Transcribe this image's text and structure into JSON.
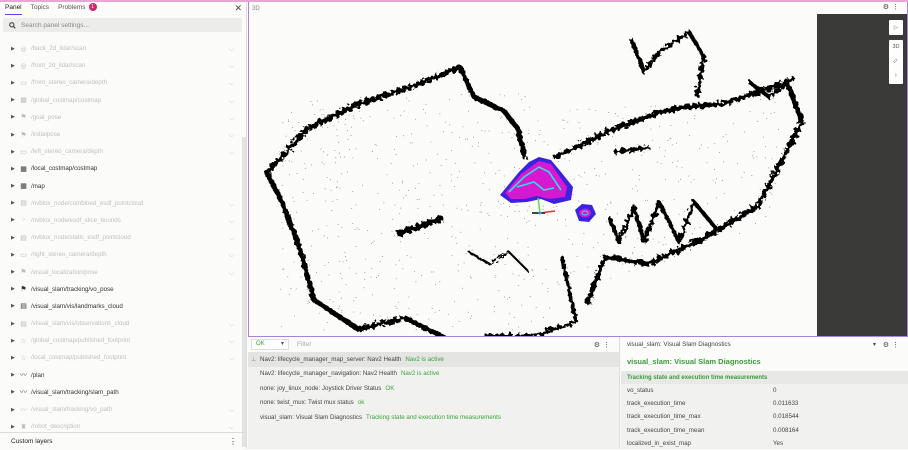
{
  "sidebar": {
    "tabs": [
      {
        "label": "Panel",
        "active": true
      },
      {
        "label": "Topics"
      },
      {
        "label": "Problems",
        "badge": "1"
      }
    ],
    "search_placeholder": "Search panel settings...",
    "topics": [
      {
        "label": "/back_2d_lidar/scan",
        "icon": "lidar-icon",
        "visible": false
      },
      {
        "label": "/front_2d_lidar/scan",
        "icon": "lidar-icon",
        "visible": false
      },
      {
        "label": "/front_stereo_camera/depth",
        "icon": "image-icon",
        "visible": false
      },
      {
        "label": "/global_costmap/costmap",
        "icon": "grid-icon",
        "visible": false
      },
      {
        "label": "/goal_pose",
        "icon": "flag-icon",
        "visible": false
      },
      {
        "label": "/initialpose",
        "icon": "flag-icon",
        "visible": false
      },
      {
        "label": "/left_stereo_camera/depth",
        "icon": "image-icon",
        "visible": false
      },
      {
        "label": "/local_costmap/costmap",
        "icon": "grid-icon",
        "visible": true
      },
      {
        "label": "/map",
        "icon": "grid-icon",
        "visible": true
      },
      {
        "label": "/nvblox_node/combined_esdf_pointcloud",
        "icon": "pointcloud-icon",
        "visible": false
      },
      {
        "label": "/nvblox_node/esdf_slice_bounds",
        "icon": "bounds-icon",
        "visible": false
      },
      {
        "label": "/nvblox_node/static_esdf_pointcloud",
        "icon": "pointcloud-icon",
        "visible": false
      },
      {
        "label": "/right_stereo_camera/depth",
        "icon": "image-icon",
        "visible": false
      },
      {
        "label": "/visual_localization/pose",
        "icon": "flag-icon",
        "visible": false
      },
      {
        "label": "/visual_slam/tracking/vo_pose",
        "icon": "flag-icon",
        "visible": true
      },
      {
        "label": "/visual_slam/vis/landmarks_cloud",
        "icon": "pointcloud-icon",
        "visible": true
      },
      {
        "label": "/visual_slam/vis/observations_cloud",
        "icon": "pointcloud-icon",
        "visible": false
      },
      {
        "label": "/global_costmap/published_footprint",
        "icon": "star-icon",
        "visible": false
      },
      {
        "label": "/local_costmap/published_footprint",
        "icon": "star-icon",
        "visible": false
      },
      {
        "label": "/plan",
        "icon": "path-icon",
        "visible": true
      },
      {
        "label": "/visual_slam/tracking/slam_path",
        "icon": "path-icon",
        "visible": true
      },
      {
        "label": "/visual_slam/tracking/vo_path",
        "icon": "path-icon",
        "visible": false
      },
      {
        "label": "/robot_description",
        "icon": "robot-icon",
        "visible": false
      }
    ],
    "custom_layers": "Custom layers"
  },
  "viewport": {
    "title": "3D",
    "mode_3d": "3D"
  },
  "diagnostics": {
    "level": "OK",
    "filter_placeholder": "Filter",
    "rows": [
      {
        "name": "Nav2: lifecycle_manager_map_server: Nav2 Health",
        "status": "Nav2 is active",
        "pinned": true
      },
      {
        "name": "Nav2: lifecycle_manager_navigation: Nav2 Health",
        "status": "Nav2 is active"
      },
      {
        "name": "none: joy_linux_node: Joystick Driver Status",
        "status": "OK"
      },
      {
        "name": "none: twist_mux: Twist mux status",
        "status": "ok"
      },
      {
        "name": "visual_slam: Visual Slam Diagnostics",
        "status": "Tracking state and execution time measurements"
      }
    ]
  },
  "detail": {
    "selected": "visual_slam: Visual Slam Diagnostics",
    "title": "visual_slam: Visual Slam Diagnostics",
    "message": "Tracking state and execution time measurements",
    "values": [
      {
        "key": "vo_status",
        "value": "0"
      },
      {
        "key": "track_execution_time",
        "value": "0.011633"
      },
      {
        "key": "track_execution_time_max",
        "value": "0.018544"
      },
      {
        "key": "track_execution_time_mean",
        "value": "0.008164"
      },
      {
        "key": "localized_in_exist_map",
        "value": "Yes"
      }
    ]
  },
  "colors": {
    "accent": "#6f3be8",
    "ok": "#3a9b3a",
    "badge": "#c42e6d"
  }
}
